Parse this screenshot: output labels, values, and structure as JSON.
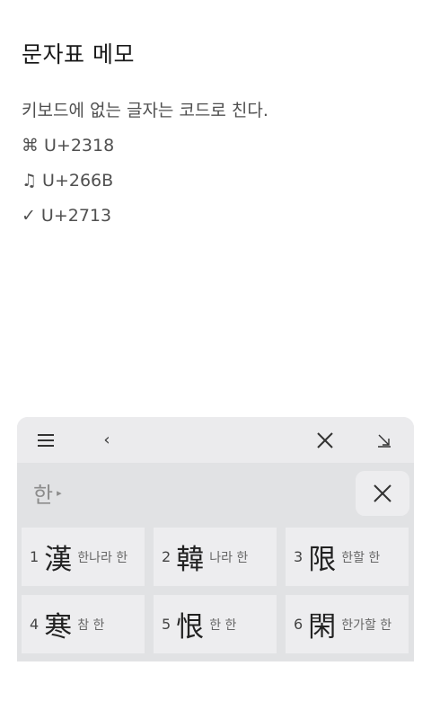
{
  "note": {
    "title": "문자표 메모",
    "lines": [
      {
        "symbol": "",
        "text": "키보드에 없는 글자는 코드로 친다."
      },
      {
        "symbol": "⌘",
        "text": "U+2318"
      },
      {
        "symbol": "♫",
        "text": "U+266B"
      },
      {
        "symbol": "✓",
        "text": "U+2713"
      }
    ]
  },
  "ime": {
    "toolbar": {
      "menu_icon": "menu-icon",
      "back_label": "‹",
      "close_icon": "close-icon",
      "minimize_icon": "minimize-arrow-icon"
    },
    "composing_text": "한",
    "composing_arrow": "▸",
    "clear_icon": "clear-icon",
    "candidates": [
      {
        "num": "1",
        "hanja": "漢",
        "reading": "한나라 한"
      },
      {
        "num": "2",
        "hanja": "韓",
        "reading": "나라 한"
      },
      {
        "num": "3",
        "hanja": "限",
        "reading": "한할 한"
      },
      {
        "num": "4",
        "hanja": "寒",
        "reading": "참 한"
      },
      {
        "num": "5",
        "hanja": "恨",
        "reading": "한 한"
      },
      {
        "num": "6",
        "hanja": "閑",
        "reading": "한가할 한"
      }
    ]
  }
}
